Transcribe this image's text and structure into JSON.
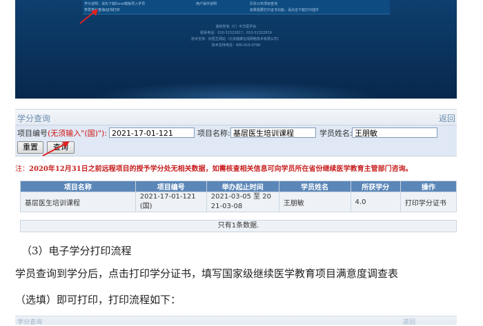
{
  "hero": {
    "links_left": [
      "学分说明：请先下载Excel模板导入学员",
      "学员学分查询/证书打印"
    ],
    "links_right": [
      "用户操作说明",
      "如果需要打印证书功能，请点击下载打印插件"
    ],
    "links_right2": [
      "历年公布项目查询",
      ""
    ],
    "footer": [
      "版权所有（C）中华医学会",
      "联系电话：010-51322817，010-51322819",
      "技术支持：好医生网站（北京健康在线网络技术有限公司）",
      "技术支持电话：400-010-0799"
    ]
  },
  "panel": {
    "title": "学分查询",
    "back": "返回",
    "project_no_label": "项目编号",
    "project_no_hint": "(无须输入\"(国)\"):",
    "project_no_value": "2021-17-01-121",
    "project_name_label": "项目名称:",
    "project_name_value": "基层医生培训课程",
    "student_name_label": "学员姓名:",
    "student_name_value": "王朋敏",
    "reset": "重置",
    "query": "查询",
    "note_prefix": "注：",
    "note": "2020年12月31日之前远程项目的授予学分处无相关数据，如需核查相关信息可向学员所在省份继续医学教育主管部门咨询。"
  },
  "table": {
    "headers": [
      "项目名称",
      "项目编号",
      "举办起止时间",
      "学员姓名",
      "所获学分",
      "操作"
    ],
    "row": {
      "name": "基层医生培训课程",
      "no_line1": "2021-17-01-121",
      "no_line2": "(国)",
      "time_line1": "2021-03-05 至 20",
      "time_line2": "21-03-08",
      "student": "王朋敏",
      "credit": "4.0",
      "action": "打印学分证书"
    },
    "summary": "只有1条数据."
  },
  "doc": {
    "heading": "（3）电子学分打印流程",
    "para1": "学员查询到学分后，点击打印学分证书，填写国家级继续医学教育项目满意度调查表",
    "para2": "（选填）即可打印，打印流程如下："
  },
  "cut": {
    "left": "学分查询",
    "right": "返回"
  }
}
